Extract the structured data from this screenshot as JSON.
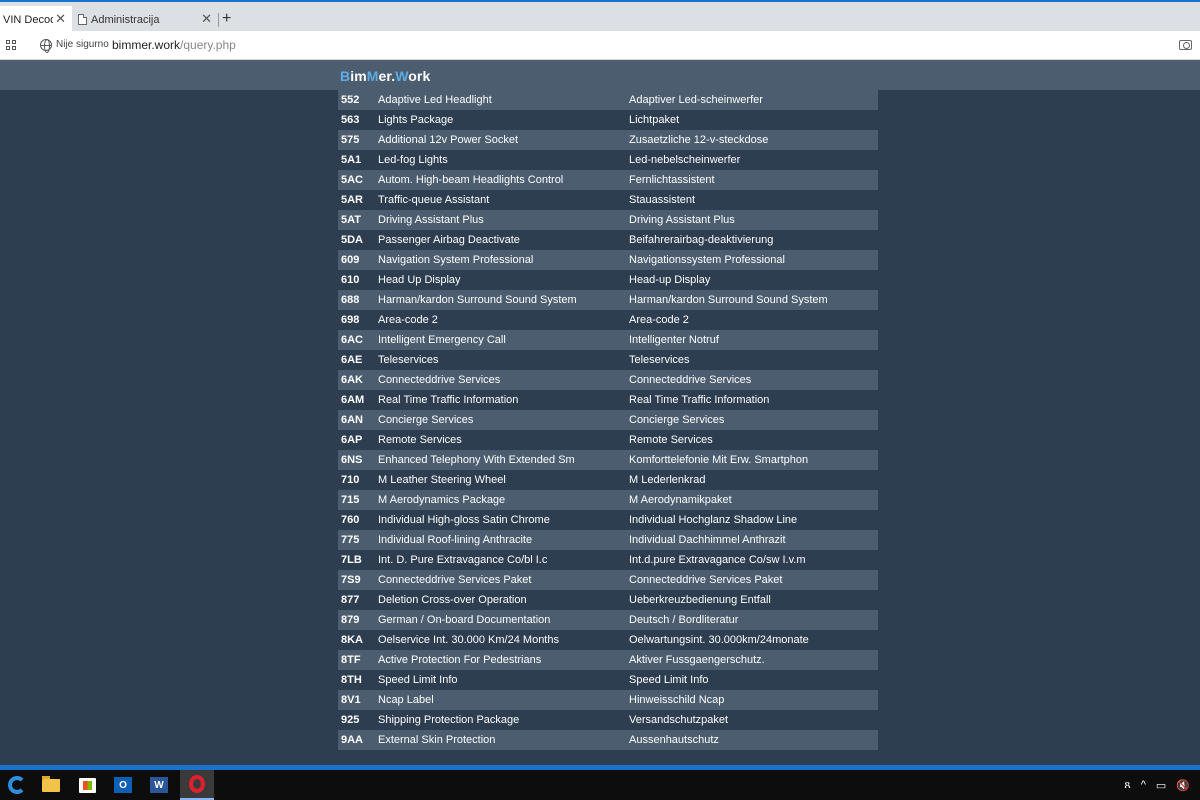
{
  "browser": {
    "tabs": [
      {
        "label": "VIN Decoder"
      },
      {
        "label": "Administracija"
      }
    ],
    "new_tab_label": "+",
    "close_glyph": "✕",
    "security_text": "Nije sigurno",
    "url_host": "bimmer.work",
    "url_path": "/query.php"
  },
  "site": {
    "logo_b1": "B",
    "logo_t1": "im",
    "logo_b2": "M",
    "logo_t2": "er.",
    "logo_b3": "W",
    "logo_t3": "ork"
  },
  "options": [
    {
      "code": "552",
      "en": "Adaptive Led Headlight",
      "de": "Adaptiver Led-scheinwerfer"
    },
    {
      "code": "563",
      "en": "Lights Package",
      "de": "Lichtpaket"
    },
    {
      "code": "575",
      "en": "Additional 12v Power Socket",
      "de": "Zusaetzliche 12-v-steckdose"
    },
    {
      "code": "5A1",
      "en": "Led-fog Lights",
      "de": "Led-nebelscheinwerfer"
    },
    {
      "code": "5AC",
      "en": "Autom. High-beam Headlights Control",
      "de": "Fernlichtassistent"
    },
    {
      "code": "5AR",
      "en": "Traffic-queue Assistant",
      "de": "Stauassistent"
    },
    {
      "code": "5AT",
      "en": "Driving Assistant Plus",
      "de": "Driving Assistant Plus"
    },
    {
      "code": "5DA",
      "en": "Passenger Airbag Deactivate",
      "de": "Beifahrerairbag-deaktivierung"
    },
    {
      "code": "609",
      "en": "Navigation System Professional",
      "de": "Navigationssystem Professional"
    },
    {
      "code": "610",
      "en": "Head Up Display",
      "de": "Head-up Display"
    },
    {
      "code": "688",
      "en": "Harman/kardon Surround Sound System",
      "de": "Harman/kardon Surround Sound System"
    },
    {
      "code": "698",
      "en": "Area-code 2",
      "de": "Area-code 2"
    },
    {
      "code": "6AC",
      "en": "Intelligent Emergency Call",
      "de": "Intelligenter Notruf"
    },
    {
      "code": "6AE",
      "en": "Teleservices",
      "de": "Teleservices"
    },
    {
      "code": "6AK",
      "en": "Connecteddrive Services",
      "de": "Connecteddrive Services"
    },
    {
      "code": "6AM",
      "en": "Real Time Traffic Information",
      "de": "Real Time Traffic Information"
    },
    {
      "code": "6AN",
      "en": "Concierge Services",
      "de": "Concierge Services"
    },
    {
      "code": "6AP",
      "en": "Remote Services",
      "de": "Remote Services"
    },
    {
      "code": "6NS",
      "en": "Enhanced Telephony With Extended Sm",
      "de": "Komforttelefonie Mit Erw. Smartphon"
    },
    {
      "code": "710",
      "en": "M Leather Steering Wheel",
      "de": "M Lederlenkrad"
    },
    {
      "code": "715",
      "en": "M Aerodynamics Package",
      "de": "M Aerodynamikpaket"
    },
    {
      "code": "760",
      "en": "Individual High-gloss Satin Chrome",
      "de": "Individual Hochglanz Shadow Line"
    },
    {
      "code": "775",
      "en": "Individual Roof-lining Anthracite",
      "de": "Individual Dachhimmel Anthrazit"
    },
    {
      "code": "7LB",
      "en": "Int. D. Pure Extravagance Co/bl I.c",
      "de": "Int.d.pure Extravagance Co/sw I.v.m"
    },
    {
      "code": "7S9",
      "en": "Connecteddrive Services Paket",
      "de": "Connecteddrive Services Paket"
    },
    {
      "code": "877",
      "en": "Deletion Cross-over Operation",
      "de": "Ueberkreuzbedienung Entfall"
    },
    {
      "code": "879",
      "en": "German / On-board Documentation",
      "de": "Deutsch / Bordliteratur"
    },
    {
      "code": "8KA",
      "en": "Oelservice Int. 30.000 Km/24 Months",
      "de": "Oelwartungsint. 30.000km/24monate"
    },
    {
      "code": "8TF",
      "en": "Active Protection For Pedestrians",
      "de": "Aktiver Fussgaengerschutz."
    },
    {
      "code": "8TH",
      "en": "Speed Limit Info",
      "de": "Speed Limit Info"
    },
    {
      "code": "8V1",
      "en": "Ncap Label",
      "de": "Hinweisschild Ncap"
    },
    {
      "code": "925",
      "en": "Shipping Protection Package",
      "de": "Versandschutzpaket"
    },
    {
      "code": "9AA",
      "en": "External Skin Protection",
      "de": "Aussenhautschutz"
    }
  ],
  "taskbar": {
    "items": [
      "edge-icon",
      "folder-icon",
      "store-icon",
      "outlook-icon",
      "word-icon",
      "opera-icon"
    ],
    "outlook_letter": "O",
    "word_letter": "W",
    "tray_people": "ጸ",
    "tray_chevron": "^",
    "tray_network": "▭",
    "tray_volume": "🔇"
  },
  "colors": {
    "page_bg": "#2c3e50",
    "row_light": "#4b5d6f",
    "accent": "#5dade2"
  }
}
